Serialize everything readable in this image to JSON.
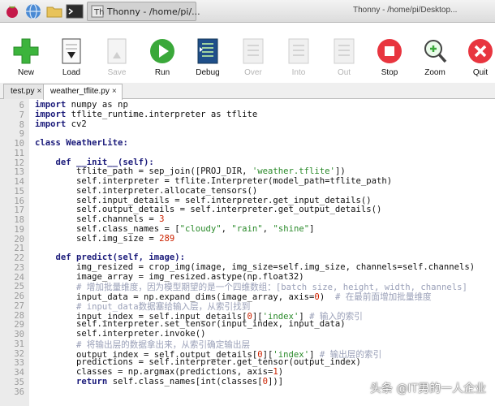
{
  "taskbar": {
    "window_button_title": "Thonny - /home/pi/...",
    "window_title": "Thonny - /home/pi/Desktop..."
  },
  "toolbar": {
    "new": "New",
    "load": "Load",
    "save": "Save",
    "run": "Run",
    "debug": "Debug",
    "over": "Over",
    "into": "Into",
    "out": "Out",
    "stop": "Stop",
    "zoom": "Zoom",
    "quit": "Quit"
  },
  "tabs": [
    {
      "label": "test.py"
    },
    {
      "label": "weather_tflite.py"
    }
  ],
  "editor": {
    "lines": [
      {
        "n": "6",
        "text": ""
      },
      {
        "n": "7",
        "text": ""
      },
      {
        "n": "8",
        "text": ""
      },
      {
        "n": "9",
        "text": ""
      },
      {
        "n": "10",
        "text": ""
      },
      {
        "n": "11",
        "text": ""
      },
      {
        "n": "12",
        "text": ""
      },
      {
        "n": "13",
        "text": ""
      },
      {
        "n": "14",
        "text": ""
      },
      {
        "n": "15",
        "text": ""
      },
      {
        "n": "16",
        "text": ""
      },
      {
        "n": "17",
        "text": ""
      },
      {
        "n": "18",
        "text": ""
      },
      {
        "n": "19",
        "text": ""
      },
      {
        "n": "20",
        "text": ""
      },
      {
        "n": "21",
        "text": ""
      },
      {
        "n": "22",
        "text": ""
      },
      {
        "n": "23",
        "text": ""
      },
      {
        "n": "24",
        "text": ""
      },
      {
        "n": "25",
        "text": ""
      },
      {
        "n": "26",
        "text": ""
      },
      {
        "n": "27",
        "text": ""
      },
      {
        "n": "28",
        "text": ""
      },
      {
        "n": "29",
        "text": ""
      },
      {
        "n": "30",
        "text": ""
      },
      {
        "n": "31",
        "text": ""
      },
      {
        "n": "32",
        "text": ""
      },
      {
        "n": "33",
        "text": ""
      },
      {
        "n": "34",
        "text": ""
      },
      {
        "n": "35",
        "text": ""
      },
      {
        "n": "36",
        "text": ""
      }
    ],
    "code": {
      "l6": "import numpy as np",
      "l7": "import tflite_runtime.interpreter as tflite",
      "l8": "import cv2",
      "l10_kw": "class ",
      "l10_name": "WeatherLite:",
      "l12_kw": "def ",
      "l12_name": "__init__(self):",
      "l13_a": "tflite_path = sep_join([PROJ_DIR, ",
      "l13_s": "'weather.tflite'",
      "l13_b": "])",
      "l14": "self.interpreter = tflite.Interpreter(model_path=tflite_path)",
      "l15": "self.interpreter.allocate_tensors()",
      "l16": "self.input_details = self.interpreter.get_input_details()",
      "l17": "self.output_details = self.interpreter.get_output_details()",
      "l18_a": "self.channels = ",
      "l18_n": "3",
      "l19_a": "self.class_names = [",
      "l19_s1": "\"cloudy\"",
      "l19_c1": ", ",
      "l19_s2": "\"rain\"",
      "l19_c2": ", ",
      "l19_s3": "\"shine\"",
      "l19_b": "]",
      "l20_a": "self.img_size = ",
      "l20_n": "289",
      "l22_kw": "def ",
      "l22_name": "predict(self, image):",
      "l23": "img_resized = crop_img(image, img_size=self.img_size, channels=self.channels)",
      "l24": "image_array = img_resized.astype(np.float32)",
      "l25": "# 增加批量维度，因为模型期望的是一个四维数组：[batch size, height, width, channels]",
      "l26_a": "input_data = np.expand_dims(image_array, axis=",
      "l26_n": "0",
      "l26_b": ")  ",
      "l26_c": "# 在最前面增加批量维度",
      "l27": "# input_data数据塞给输入层，从索引找到",
      "l28_a": "input_index = self.input_details[",
      "l28_n": "0",
      "l28_b": "][",
      "l28_s": "'index'",
      "l28_d": "] ",
      "l28_c": "# 输入的索引",
      "l29": "self.interpreter.set_tensor(input_index, input_data)",
      "l30": "self.interpreter.invoke()",
      "l31": "# 将输出层的数据拿出来，从索引确定输出层",
      "l32_a": "output_index = self.output_details[",
      "l32_n": "0",
      "l32_b": "][",
      "l32_s": "'index'",
      "l32_d": "] ",
      "l32_c": "# 输出层的索引",
      "l33": "predictions = self.interpreter.get_tensor(output_index)",
      "l34_a": "classes = np.argmax(predictions, axis=",
      "l34_n": "1",
      "l34_b": ")",
      "l35_kw": "return ",
      "l35_a": "self.class_names[int(classes[",
      "l35_n": "0",
      "l35_b": "])]"
    }
  },
  "watermark": "头条 @IT男的一人企业",
  "colors": {
    "new_green": "#3cb43c",
    "run_green": "#3aa83a",
    "stop_red": "#e8353f",
    "quit_red": "#e8353f",
    "gutter_bg": "#ebebeb"
  }
}
